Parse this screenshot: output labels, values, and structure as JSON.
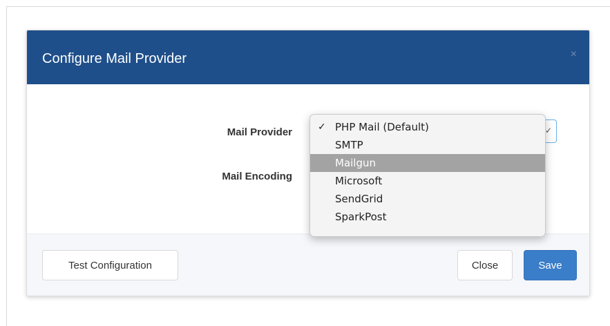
{
  "modal": {
    "title": "Configure Mail Provider",
    "close_icon": "×"
  },
  "form": {
    "mail_provider_label": "Mail Provider",
    "mail_encoding_label": "Mail Encoding",
    "select_chevron": "✓"
  },
  "dropdown": {
    "checkmark": "✓",
    "selected": "PHP Mail (Default)",
    "highlighted": "Mailgun",
    "options": [
      "PHP Mail (Default)",
      "SMTP",
      "Mailgun",
      "Microsoft",
      "SendGrid",
      "SparkPost"
    ]
  },
  "footer": {
    "test_label": "Test Configuration",
    "close_label": "Close",
    "save_label": "Save"
  },
  "colors": {
    "header_bg": "#1f4f8a",
    "primary": "#3a7dc9",
    "highlight": "#a3a3a3"
  }
}
